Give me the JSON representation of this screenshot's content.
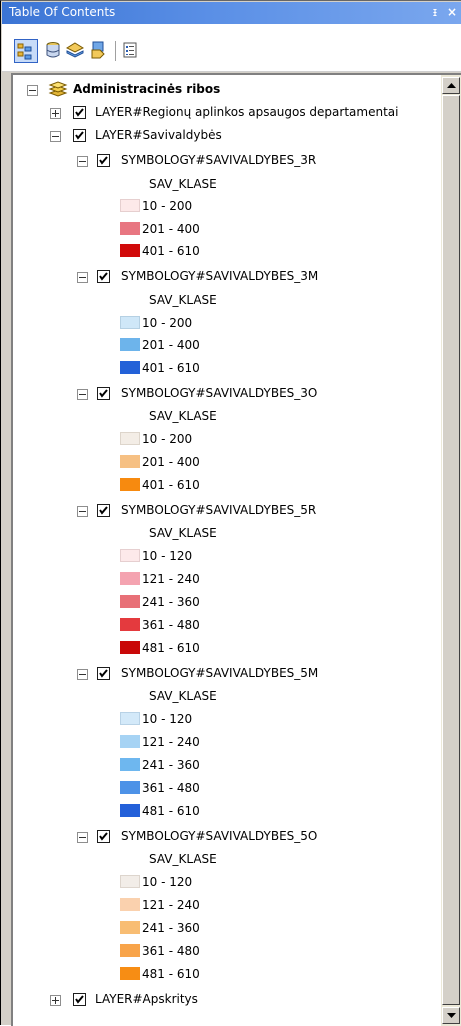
{
  "window": {
    "title": "Table Of Contents",
    "pin_glyph": "ᵻ",
    "close_glyph": "×"
  },
  "toolbar": {
    "buttons": [
      {
        "icon": "list-by-drawing-order-icon",
        "active": true
      },
      {
        "icon": "list-by-source-icon"
      },
      {
        "icon": "list-by-visibility-icon"
      },
      {
        "icon": "list-by-selection-icon"
      },
      {
        "icon": "options-icon"
      }
    ]
  },
  "tree": {
    "group": {
      "label": "Administracinės ribos",
      "icon": "layer-group-icon"
    },
    "layer_regions": {
      "label": "LAYER#Regionų aplinkos apsaugos departamentai",
      "checked": true,
      "expanded": false
    },
    "layer_municipalities": {
      "label": "LAYER#Savivaldybės",
      "checked": true,
      "expanded": true
    },
    "symbologies": [
      {
        "label": "SYMBOLOGY#SAVIVALDYBES_3R",
        "field": "SAV_KLASE",
        "classes": [
          {
            "range": "10 - 200",
            "color": "#fde9e9"
          },
          {
            "range": "201 - 400",
            "color": "#e87681"
          },
          {
            "range": "401 - 610",
            "color": "#d10a0a"
          }
        ]
      },
      {
        "label": "SYMBOLOGY#SAVIVALDYBES_3M",
        "field": "SAV_KLASE",
        "classes": [
          {
            "range": "10 - 200",
            "color": "#cfe7f8"
          },
          {
            "range": "201 - 400",
            "color": "#6db4eb"
          },
          {
            "range": "401 - 610",
            "color": "#2361d8"
          }
        ]
      },
      {
        "label": "SYMBOLOGY#SAVIVALDYBES_3O",
        "field": "SAV_KLASE",
        "classes": [
          {
            "range": "10 - 200",
            "color": "#f3ede6"
          },
          {
            "range": "201 - 400",
            "color": "#f6c083"
          },
          {
            "range": "401 - 610",
            "color": "#f78a0f"
          }
        ]
      },
      {
        "label": "SYMBOLOGY#SAVIVALDYBES_5R",
        "field": "SAV_KLASE",
        "classes": [
          {
            "range": "10 - 120",
            "color": "#fde9ea"
          },
          {
            "range": "121 - 240",
            "color": "#f4a3b0"
          },
          {
            "range": "241 - 360",
            "color": "#e87077"
          },
          {
            "range": "361 - 480",
            "color": "#e43a3e"
          },
          {
            "range": "481 - 610",
            "color": "#c90808"
          }
        ]
      },
      {
        "label": "SYMBOLOGY#SAVIVALDYBES_5M",
        "field": "SAV_KLASE",
        "classes": [
          {
            "range": "10 - 120",
            "color": "#d3e9f9"
          },
          {
            "range": "121 - 240",
            "color": "#a6d3f4"
          },
          {
            "range": "241 - 360",
            "color": "#6eb7ef"
          },
          {
            "range": "361 - 480",
            "color": "#4d92e7"
          },
          {
            "range": "481 - 610",
            "color": "#2360d9"
          }
        ]
      },
      {
        "label": "SYMBOLOGY#SAVIVALDYBES_5O",
        "field": "SAV_KLASE",
        "classes": [
          {
            "range": "10 - 120",
            "color": "#f2ede8"
          },
          {
            "range": "121 - 240",
            "color": "#fad1ae"
          },
          {
            "range": "241 - 360",
            "color": "#f8bd73"
          },
          {
            "range": "361 - 480",
            "color": "#f8a44a"
          },
          {
            "range": "481 - 610",
            "color": "#f78d14"
          }
        ]
      }
    ],
    "layer_counties": {
      "label": "LAYER#Apskritys",
      "checked": true,
      "expanded": false
    }
  }
}
